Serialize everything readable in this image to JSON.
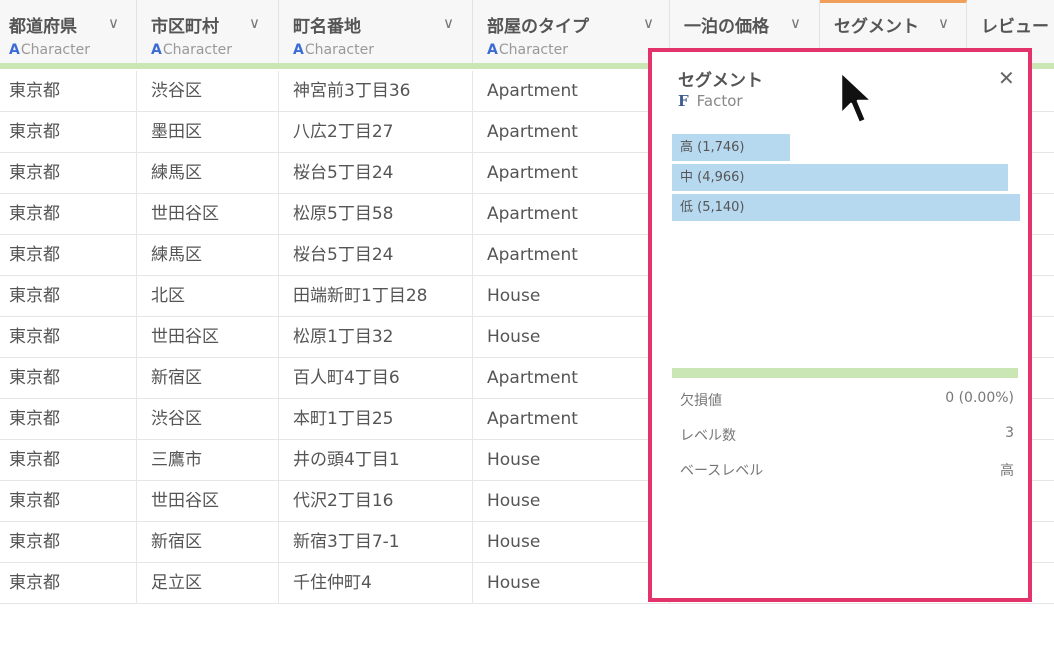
{
  "columns": [
    {
      "name": "都道府県",
      "type_icon": "A",
      "type": "Character"
    },
    {
      "name": "市区町村",
      "type_icon": "A",
      "type": "Character"
    },
    {
      "name": "町名番地",
      "type_icon": "A",
      "type": "Character"
    },
    {
      "name": "部屋のタイプ",
      "type_icon": "A",
      "type": "Character"
    },
    {
      "name": "一泊の価格",
      "type_icon": "",
      "type": ""
    },
    {
      "name": "セグメント",
      "type_icon": "",
      "type": ""
    },
    {
      "name": "レビュー",
      "type_icon": "",
      "type": ""
    }
  ],
  "rows": [
    [
      "東京都",
      "渋谷区",
      "神宮前3丁目36",
      "Apartment"
    ],
    [
      "東京都",
      "墨田区",
      "八広2丁目27",
      "Apartment"
    ],
    [
      "東京都",
      "練馬区",
      "桜台5丁目24",
      "Apartment"
    ],
    [
      "東京都",
      "世田谷区",
      "松原5丁目58",
      "Apartment"
    ],
    [
      "東京都",
      "練馬区",
      "桜台5丁目24",
      "Apartment"
    ],
    [
      "東京都",
      "北区",
      "田端新町1丁目28",
      "House"
    ],
    [
      "東京都",
      "世田谷区",
      "松原1丁目32",
      "House"
    ],
    [
      "東京都",
      "新宿区",
      "百人町4丁目6",
      "Apartment"
    ],
    [
      "東京都",
      "渋谷区",
      "本町1丁目25",
      "Apartment"
    ],
    [
      "東京都",
      "三鷹市",
      "井の頭4丁目1",
      "House"
    ],
    [
      "東京都",
      "世田谷区",
      "代沢2丁目16",
      "House"
    ],
    [
      "東京都",
      "新宿区",
      "新宿3丁目7-1",
      "House"
    ],
    [
      "東京都",
      "足立区",
      "千住仲町4",
      "House"
    ]
  ],
  "popup": {
    "title": "セグメント",
    "type_icon": "F",
    "type": "Factor",
    "close": "✕",
    "levels": [
      {
        "label": "高 (1,746)",
        "count": 1746
      },
      {
        "label": "中 (4,966)",
        "count": 4966
      },
      {
        "label": "低 (5,140)",
        "count": 5140
      }
    ],
    "stats": [
      {
        "label": "欠損値",
        "value": "0 (0.00%)"
      },
      {
        "label": "レベル数",
        "value": "3"
      },
      {
        "label": "ベースレベル",
        "value": "高"
      }
    ]
  },
  "colors": {
    "accent_border": "#e2336a",
    "bar_fill": "#b7d9f0",
    "quality_bar": "#c9e6b4"
  }
}
